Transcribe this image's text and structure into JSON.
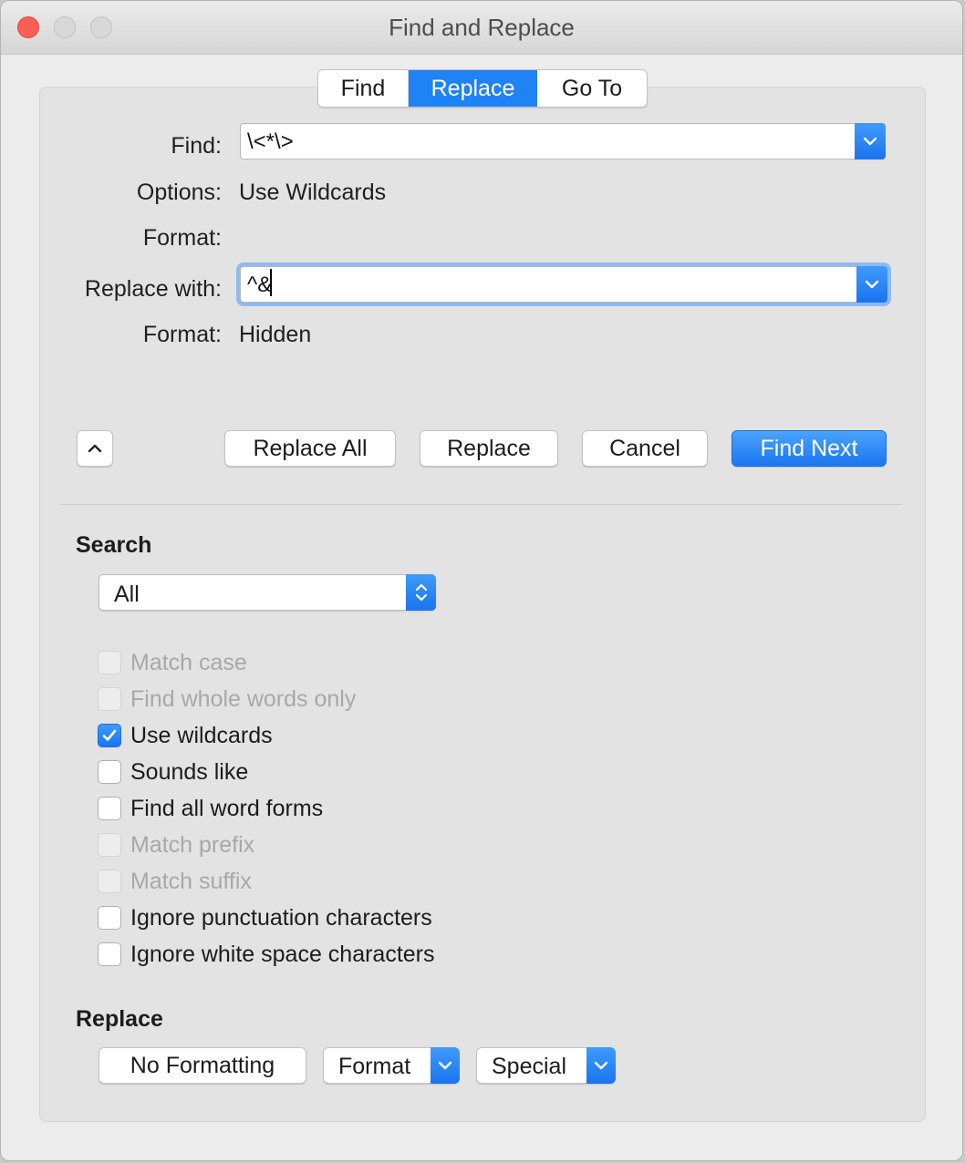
{
  "window": {
    "title": "Find and Replace"
  },
  "tabs": [
    {
      "label": "Find"
    },
    {
      "label": "Replace",
      "selected": true
    },
    {
      "label": "Go To"
    }
  ],
  "form": {
    "find_label": "Find:",
    "find_value": "\\<*\\>",
    "options_label": "Options:",
    "options_value": "Use Wildcards",
    "format_label": "Format:",
    "format_value": "",
    "replace_label": "Replace with:",
    "replace_value": "^&",
    "replace_format_label": "Format:",
    "replace_format_value": "Hidden"
  },
  "actions": {
    "collapse_icon": "chevron-up-icon",
    "replace_all": "Replace All",
    "replace": "Replace",
    "cancel": "Cancel",
    "find_next": "Find Next"
  },
  "search": {
    "heading": "Search",
    "scope": "All",
    "options": [
      {
        "label": "Match case",
        "checked": false,
        "enabled": false
      },
      {
        "label": "Find whole words only",
        "checked": false,
        "enabled": false
      },
      {
        "label": "Use wildcards",
        "checked": true,
        "enabled": true
      },
      {
        "label": "Sounds like",
        "checked": false,
        "enabled": true
      },
      {
        "label": "Find all word forms",
        "checked": false,
        "enabled": true
      },
      {
        "label": "Match prefix",
        "checked": false,
        "enabled": false
      },
      {
        "label": "Match suffix",
        "checked": false,
        "enabled": false
      },
      {
        "label": "Ignore punctuation characters",
        "checked": false,
        "enabled": true
      },
      {
        "label": "Ignore white space characters",
        "checked": false,
        "enabled": true
      }
    ]
  },
  "replace_section": {
    "heading": "Replace",
    "no_formatting": "No Formatting",
    "format": "Format",
    "special": "Special"
  },
  "colors": {
    "accent": "#1f82f5",
    "disabled_text": "#a8a8a8",
    "close_light": "#fd5f57"
  }
}
